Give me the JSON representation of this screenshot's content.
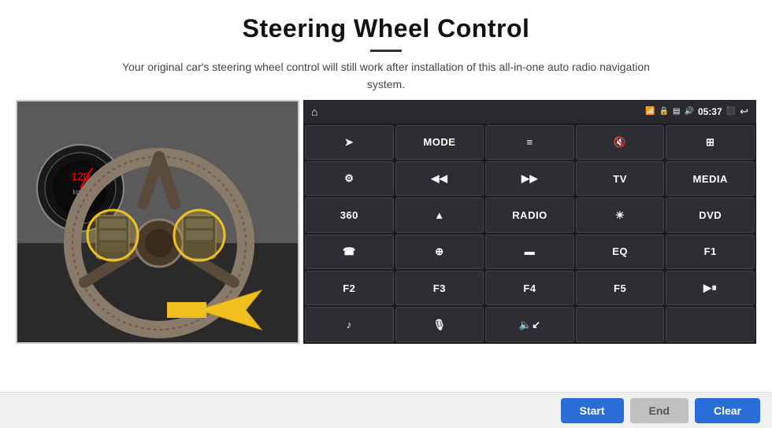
{
  "header": {
    "title": "Steering Wheel Control",
    "subtitle": "Your original car's steering wheel control will still work after installation of this all-in-one auto radio navigation system."
  },
  "status_bar": {
    "home_icon": "⌂",
    "wifi_icon": "📶",
    "lock_icon": "🔒",
    "sd_icon": "💾",
    "bt_icon": "🔊",
    "time": "05:37",
    "screen_icon": "⬛",
    "back_icon": "↩"
  },
  "buttons": [
    {
      "id": "b1",
      "label": "",
      "icon": "nav-arrow",
      "glyph": "➤"
    },
    {
      "id": "b2",
      "label": "MODE",
      "icon": null,
      "glyph": ""
    },
    {
      "id": "b3",
      "label": "",
      "icon": "list",
      "glyph": "☰"
    },
    {
      "id": "b4",
      "label": "",
      "icon": "mute",
      "glyph": "🔇"
    },
    {
      "id": "b5",
      "label": "",
      "icon": "apps",
      "glyph": "⊞"
    },
    {
      "id": "b6",
      "label": "",
      "icon": "settings-dial",
      "glyph": "◎"
    },
    {
      "id": "b7",
      "label": "",
      "icon": "prev",
      "glyph": "⏮"
    },
    {
      "id": "b8",
      "label": "",
      "icon": "next",
      "glyph": "⏭"
    },
    {
      "id": "b9",
      "label": "TV",
      "icon": null,
      "glyph": ""
    },
    {
      "id": "b10",
      "label": "MEDIA",
      "icon": null,
      "glyph": ""
    },
    {
      "id": "b11",
      "label": "",
      "icon": "360cam",
      "glyph": "360°"
    },
    {
      "id": "b12",
      "label": "",
      "icon": "eject",
      "glyph": "⏏"
    },
    {
      "id": "b13",
      "label": "RADIO",
      "icon": null,
      "glyph": ""
    },
    {
      "id": "b14",
      "label": "",
      "icon": "brightness",
      "glyph": "☀"
    },
    {
      "id": "b15",
      "label": "DVD",
      "icon": null,
      "glyph": ""
    },
    {
      "id": "b16",
      "label": "",
      "icon": "phone",
      "glyph": "📞"
    },
    {
      "id": "b17",
      "label": "",
      "icon": "swipe",
      "glyph": "↻"
    },
    {
      "id": "b18",
      "label": "",
      "icon": "screen-fit",
      "glyph": "▭"
    },
    {
      "id": "b19",
      "label": "EQ",
      "icon": null,
      "glyph": ""
    },
    {
      "id": "b20",
      "label": "F1",
      "icon": null,
      "glyph": ""
    },
    {
      "id": "b21",
      "label": "F2",
      "icon": null,
      "glyph": ""
    },
    {
      "id": "b22",
      "label": "F3",
      "icon": null,
      "glyph": ""
    },
    {
      "id": "b23",
      "label": "F4",
      "icon": null,
      "glyph": ""
    },
    {
      "id": "b24",
      "label": "F5",
      "icon": null,
      "glyph": ""
    },
    {
      "id": "b25",
      "label": "",
      "icon": "play-pause",
      "glyph": "⏯"
    },
    {
      "id": "b26",
      "label": "",
      "icon": "music",
      "glyph": "♫"
    },
    {
      "id": "b27",
      "label": "",
      "icon": "mic",
      "glyph": "🎤"
    },
    {
      "id": "b28",
      "label": "",
      "icon": "vol-call",
      "glyph": "🔈/📞"
    },
    {
      "id": "b29",
      "label": "",
      "icon": "empty",
      "glyph": ""
    },
    {
      "id": "b30",
      "label": "",
      "icon": "empty2",
      "glyph": ""
    }
  ],
  "bottom_bar": {
    "start_label": "Start",
    "end_label": "End",
    "clear_label": "Clear"
  }
}
